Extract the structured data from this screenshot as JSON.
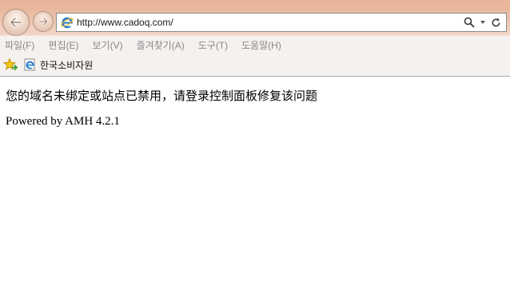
{
  "browser": {
    "address_bar": {
      "url": "http://www.cadoq.com/"
    },
    "menu": [
      "파일(F)",
      "편집(E)",
      "보기(V)",
      "즐겨찾기(A)",
      "도구(T)",
      "도움말(H)"
    ],
    "favorites": {
      "link_label": "한국소비자원"
    }
  },
  "page": {
    "message": "您的域名未绑定或站点已禁用，请登录控制面板修复该问题",
    "powered_by": "Powered by AMH 4.2.1"
  },
  "colors": {
    "chrome_top": "#e7b49a",
    "toolbar": "#f4f1ef",
    "ie_blue": "#1f7ad2"
  }
}
